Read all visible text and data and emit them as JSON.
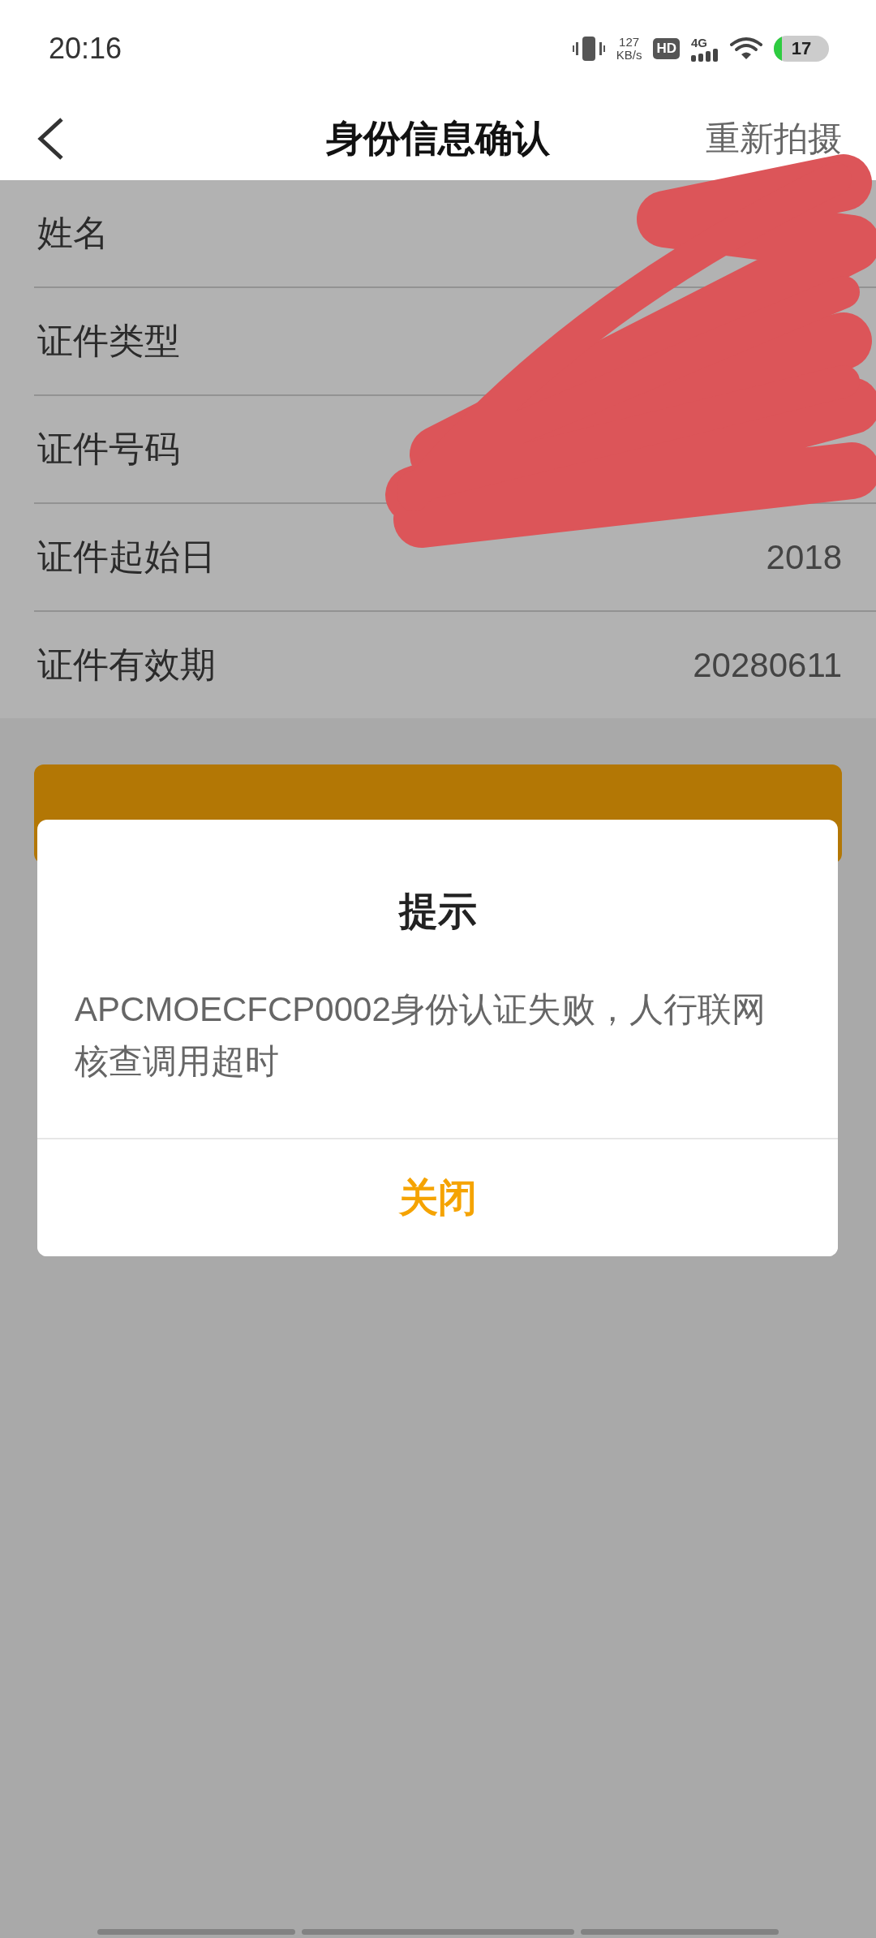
{
  "status_bar": {
    "time": "20:16",
    "net_speed": "127",
    "net_unit": "KB/s",
    "hd": "HD",
    "network": "4G",
    "battery": "17"
  },
  "header": {
    "title": "身份信息确认",
    "action": "重新拍摄"
  },
  "fields": [
    {
      "label": "姓名"
    },
    {
      "label": "证件类型"
    },
    {
      "label": "证件号码"
    },
    {
      "label": "证件起始日",
      "value": "2018"
    },
    {
      "label": "证件有效期",
      "value": "20280611"
    }
  ],
  "dialog": {
    "title": "提示",
    "message": "APCMOECFCP0002身份认证失败，人行联网核查调用超时",
    "button": "关闭"
  }
}
